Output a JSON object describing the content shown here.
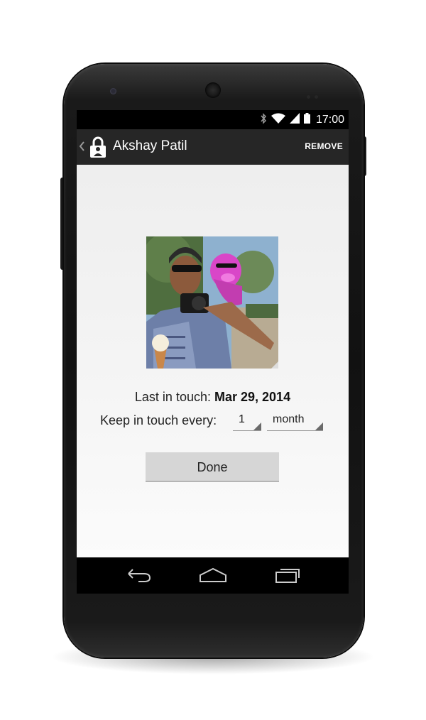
{
  "status_bar": {
    "time": "17:00",
    "icons": [
      "bluetooth-icon",
      "wifi-icon",
      "cell-signal-icon",
      "battery-icon"
    ]
  },
  "action_bar": {
    "up_icon": "chevron-left-icon",
    "app_icon": "lock-icon",
    "title": "Akshay Patil",
    "action_label": "REMOVE"
  },
  "contact": {
    "photo_icon": "contact-photo",
    "last_in_touch_label": "Last in touch:",
    "last_in_touch_date": "Mar 29, 2014",
    "keep_in_touch_label": "Keep in touch every:",
    "interval_value": "1",
    "interval_unit": "month",
    "done_label": "Done"
  },
  "nav_bar": {
    "icons": [
      "back-icon",
      "home-icon",
      "recents-icon"
    ]
  },
  "colors": {
    "action_bar": "#262626",
    "status_bar": "#000000",
    "content_bg": "#f2f2f2",
    "button_bg": "#d6d6d6"
  }
}
